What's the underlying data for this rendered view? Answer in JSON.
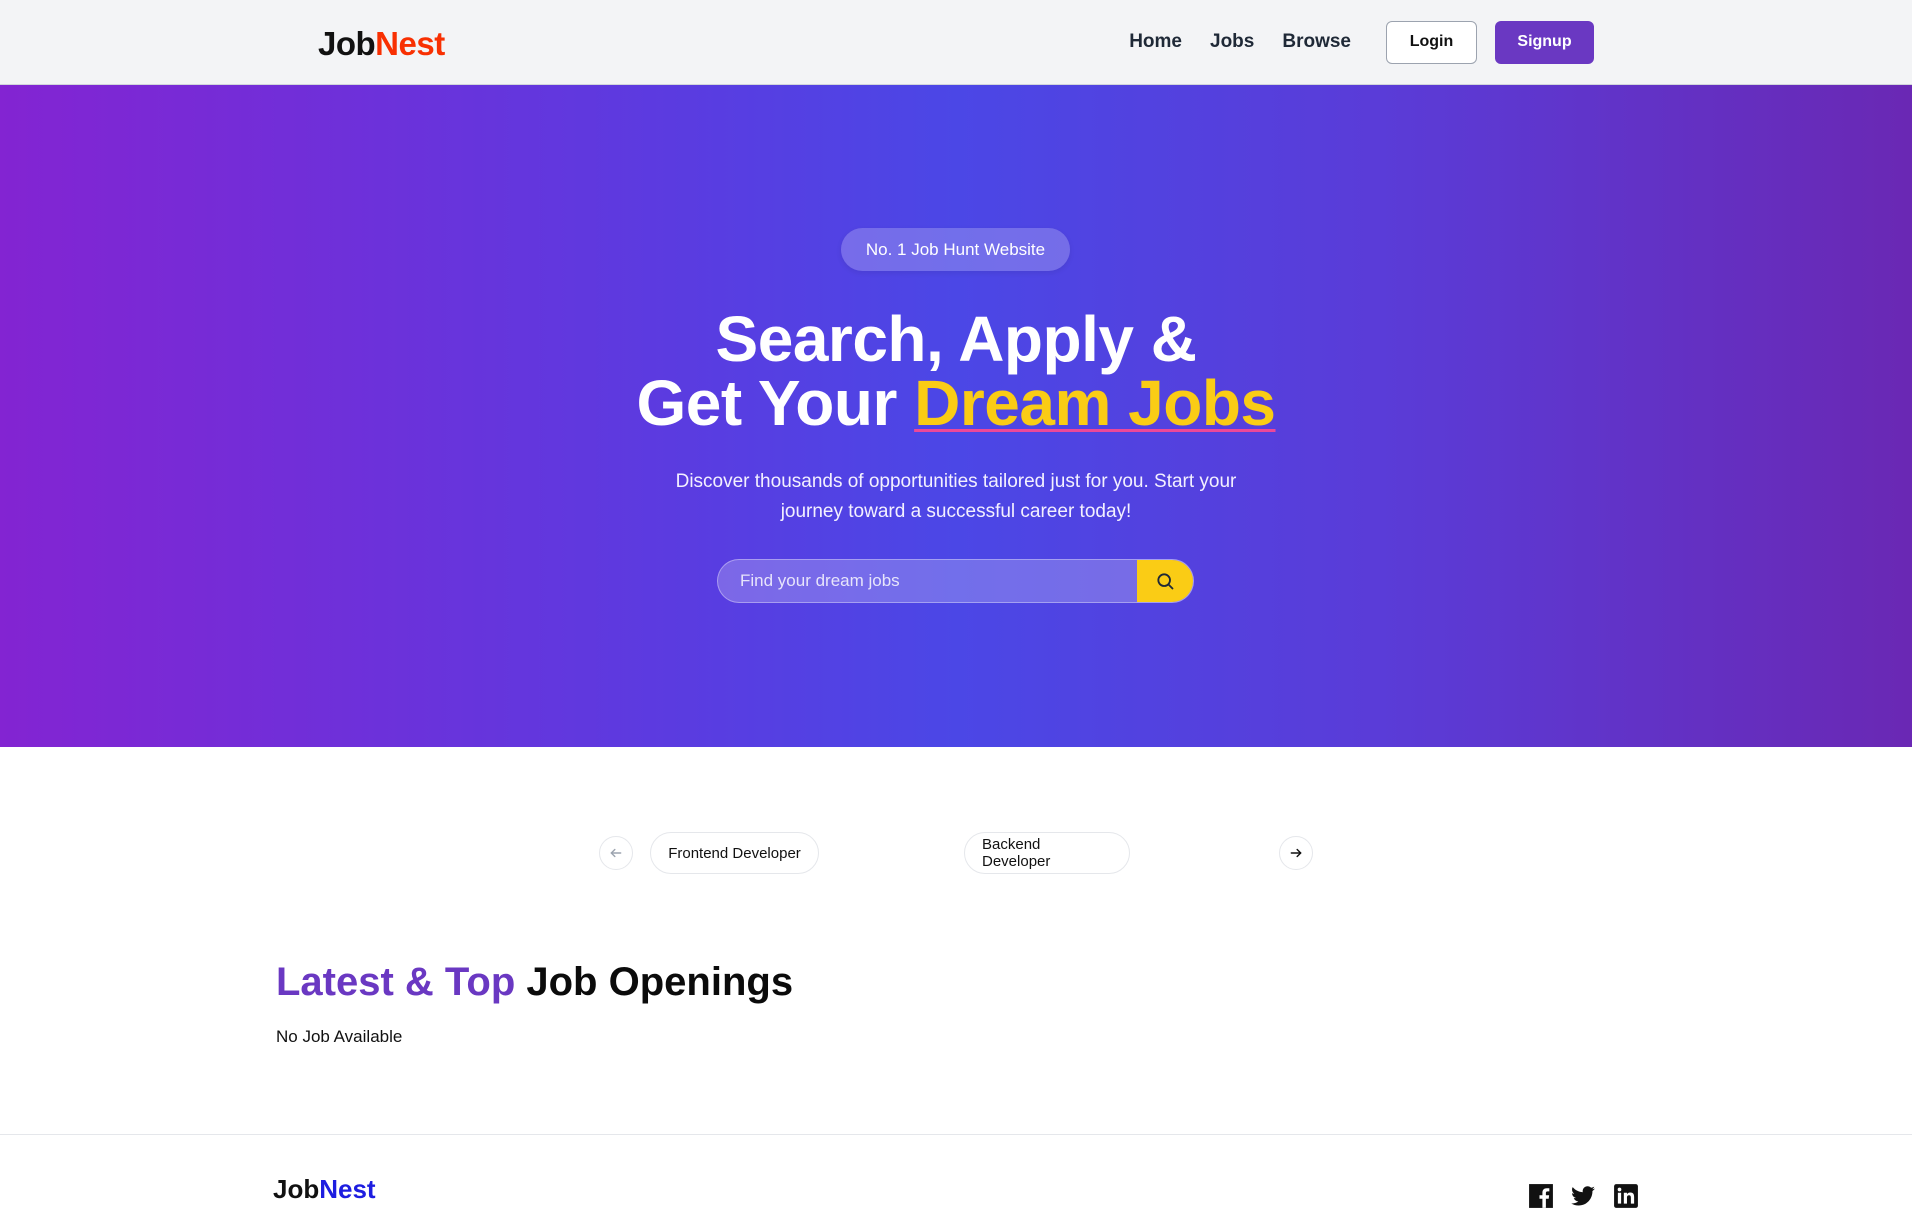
{
  "header": {
    "logo": {
      "part1": "Job",
      "part2": "Nest"
    },
    "nav": {
      "home": "Home",
      "jobs": "Jobs",
      "browse": "Browse"
    },
    "login_label": "Login",
    "signup_label": "Signup"
  },
  "hero": {
    "badge": "No. 1 Job Hunt Website",
    "headline_line1": "Search, Apply &",
    "headline_line2_prefix": "Get Your ",
    "headline_line2_accent": "Dream Jobs",
    "subtitle": "Discover thousands of opportunities tailored just for you. Start your journey toward a successful career today!",
    "search": {
      "placeholder": "Find your dream jobs",
      "value": "",
      "button_icon": "search-icon"
    }
  },
  "carousel": {
    "prev_icon": "arrow-left-icon",
    "next_icon": "arrow-right-icon",
    "items": [
      "Frontend Developer",
      "Backend Developer"
    ]
  },
  "latest_jobs": {
    "title_accent": "Latest & Top",
    "title_rest": " Job Openings",
    "empty_text": "No Job Available"
  },
  "footer": {
    "logo": {
      "part1": "Job",
      "part2": "Nest"
    },
    "social_icons": [
      "facebook-icon",
      "twitter-icon",
      "linkedin-icon"
    ]
  },
  "colors": {
    "brand_purple": "#6a38c2",
    "logo_red": "#f83002",
    "accent_yellow": "#facc15",
    "underline_pink": "#ec4899",
    "footer_logo_blue": "#1d1de0"
  }
}
